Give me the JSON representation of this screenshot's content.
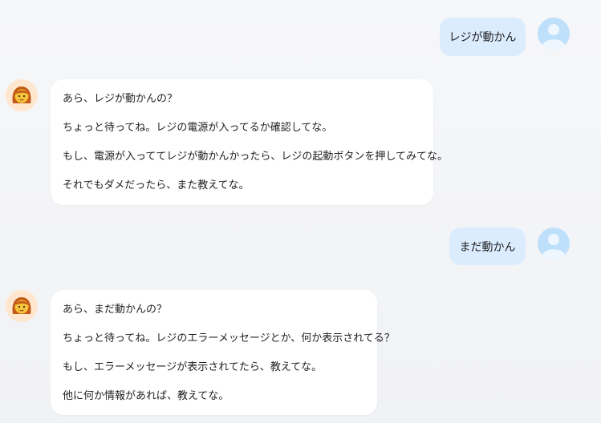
{
  "messages": [
    {
      "role": "user",
      "text": "レジが動かん"
    },
    {
      "role": "assistant",
      "lines": [
        "あら、レジが動かんの？",
        "ちょっと待ってね。レジの電源が入ってるか確認してな。",
        "もし、電源が入っててレジが動かんかったら、レジの起動ボタンを押してみてな。",
        "それでもダメだったら、また教えてな。"
      ]
    },
    {
      "role": "user",
      "text": "まだ動かん"
    },
    {
      "role": "assistant",
      "lines": [
        "あら、まだ動かんの？",
        "ちょっと待ってね。レジのエラーメッセージとか、何か表示されてる？",
        "もし、エラーメッセージが表示されてたら、教えてな。",
        "他に何か情報があれば、教えてな。"
      ]
    }
  ],
  "icons": {
    "user_avatar": "user-silhouette-icon",
    "assistant_avatar": "woman-emoji-icon"
  },
  "colors": {
    "user_bubble": "#dcecff",
    "assistant_bubble": "#ffffff",
    "user_avatar_bg": "#bfe0fb",
    "assistant_avatar_bg": "#ffe6cf"
  }
}
